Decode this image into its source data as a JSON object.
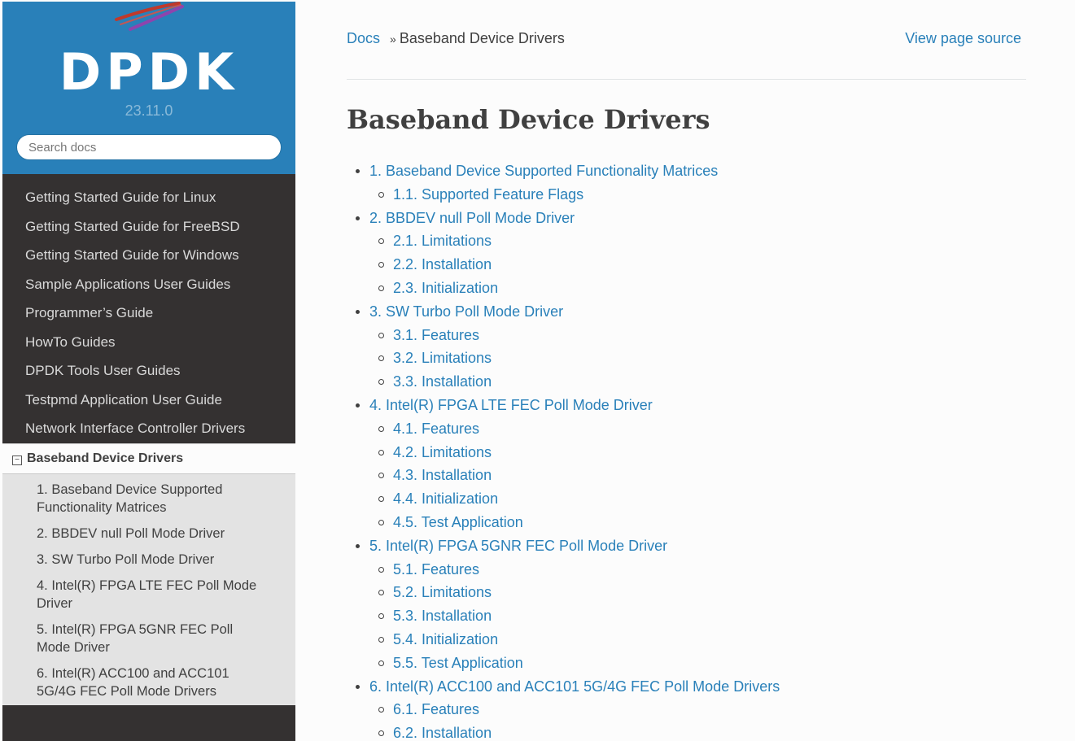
{
  "brand": {
    "logo": "DPDK",
    "version": "23.11.0"
  },
  "search": {
    "placeholder": "Search docs"
  },
  "nav": {
    "items": [
      "Getting Started Guide for Linux",
      "Getting Started Guide for FreeBSD",
      "Getting Started Guide for Windows",
      "Sample Applications User Guides",
      "Programmer’s Guide",
      "HowTo Guides",
      "DPDK Tools User Guides",
      "Testpmd Application User Guide",
      "Network Interface Controller Drivers"
    ],
    "current": "Baseband Device Drivers",
    "toggle_glyph": "−",
    "sub_items": [
      "1. Baseband Device Supported Functionality Matrices",
      "2. BBDEV null Poll Mode Driver",
      "3. SW Turbo Poll Mode Driver",
      "4. Intel(R) FPGA LTE FEC Poll Mode Driver",
      "5. Intel(R) FPGA 5GNR FEC Poll Mode Driver",
      "6. Intel(R) ACC100 and ACC101 5G/4G FEC Poll Mode Drivers"
    ]
  },
  "breadcrumb": {
    "docs": "Docs",
    "separator": "»",
    "current": "Baseband Device Drivers",
    "view_source": "View page source"
  },
  "page_title": "Baseband Device Drivers",
  "toc": [
    {
      "label": "1. Baseband Device Supported Functionality Matrices",
      "children": [
        "1.1. Supported Feature Flags"
      ]
    },
    {
      "label": "2. BBDEV null Poll Mode Driver",
      "children": [
        "2.1. Limitations",
        "2.2. Installation",
        "2.3. Initialization"
      ]
    },
    {
      "label": "3. SW Turbo Poll Mode Driver",
      "children": [
        "3.1. Features",
        "3.2. Limitations",
        "3.3. Installation"
      ]
    },
    {
      "label": "4. Intel(R) FPGA LTE FEC Poll Mode Driver",
      "children": [
        "4.1. Features",
        "4.2. Limitations",
        "4.3. Installation",
        "4.4. Initialization",
        "4.5. Test Application"
      ]
    },
    {
      "label": "5. Intel(R) FPGA 5GNR FEC Poll Mode Driver",
      "children": [
        "5.1. Features",
        "5.2. Limitations",
        "5.3. Installation",
        "5.4. Initialization",
        "5.5. Test Application"
      ]
    },
    {
      "label": "6. Intel(R) ACC100 and ACC101 5G/4G FEC Poll Mode Drivers",
      "children": [
        "6.1. Features",
        "6.2. Installation"
      ]
    }
  ],
  "colors": {
    "brand": "#2980b9",
    "sidebar": "#343131",
    "link": "#2980b9",
    "text": "#404040"
  }
}
